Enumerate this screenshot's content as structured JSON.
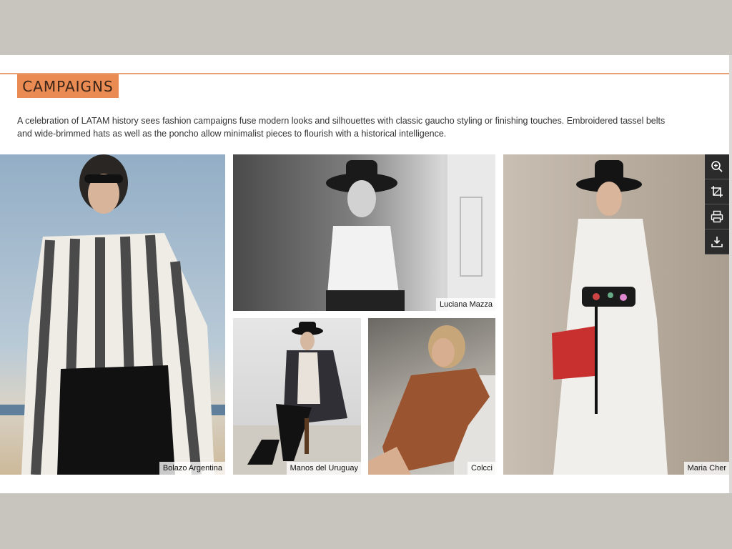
{
  "section": {
    "title": "CAMPAIGNS",
    "intro": "A celebration of LATAM history sees fashion campaigns fuse modern looks and silhouettes with classic gaucho styling or finishing touches. Embroidered tassel belts and wide-brimmed hats as well as the poncho allow minimalist pieces to flourish with a historical intelligence."
  },
  "photos": [
    {
      "caption": "Bolazo Argentina"
    },
    {
      "caption": "Luciana Mazza"
    },
    {
      "caption": "Manos del Uruguay"
    },
    {
      "caption": "Colcci"
    },
    {
      "caption": "Maria Cher"
    }
  ],
  "toolbar": {
    "items": [
      {
        "icon": "zoom-in-icon"
      },
      {
        "icon": "crop-icon"
      },
      {
        "icon": "print-icon"
      },
      {
        "icon": "download-icon"
      }
    ]
  },
  "colors": {
    "accent": "#e98b52",
    "rule": "#e8a078",
    "frame": "#c8c4be",
    "toolbar": "#2b2b2b"
  }
}
